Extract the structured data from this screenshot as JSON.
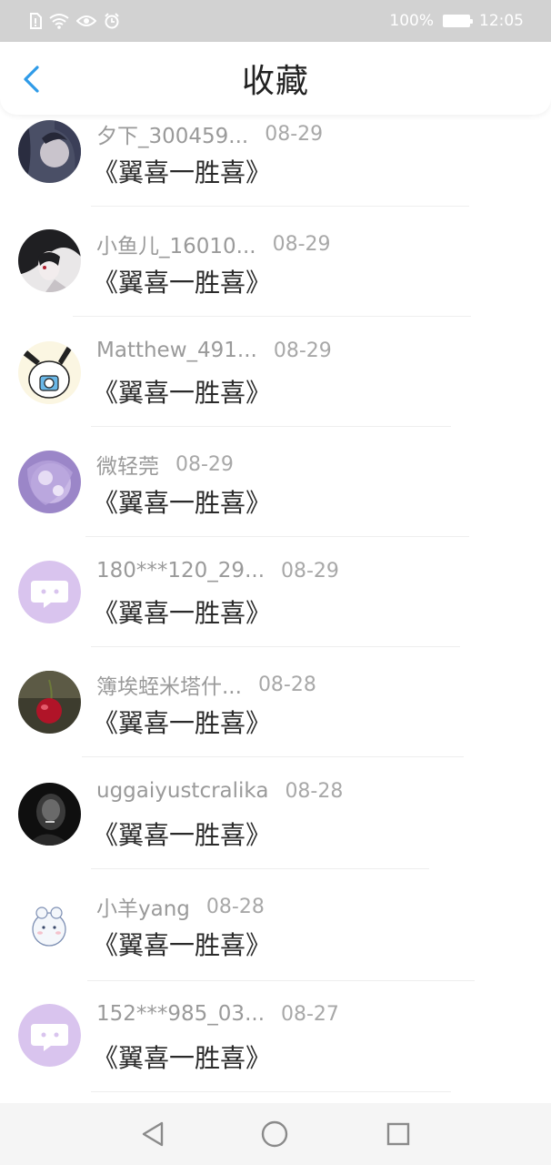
{
  "status_bar": {
    "battery": "100%",
    "time": "12:05"
  },
  "header": {
    "title": "收藏"
  },
  "items": [
    {
      "name": "夕下_300459...",
      "date": "08-29",
      "book": "《翼喜一胜喜》"
    },
    {
      "name": "小鱼儿_16010...",
      "date": "08-29",
      "book": "《翼喜一胜喜》"
    },
    {
      "name": "Matthew_491...",
      "date": "08-29",
      "book": "《翼喜一胜喜》"
    },
    {
      "name": "微轻莞",
      "date": "08-29",
      "book": "《翼喜一胜喜》"
    },
    {
      "name": "180***120_29...",
      "date": "08-29",
      "book": "《翼喜一胜喜》"
    },
    {
      "name": "簿埃蛭米塔什...",
      "date": "08-28",
      "book": "《翼喜一胜喜》"
    },
    {
      "name": "uggaiyustcralika",
      "date": "08-28",
      "book": "《翼喜一胜喜》"
    },
    {
      "name": "小羊yang",
      "date": "08-28",
      "book": "《翼喜一胜喜》"
    },
    {
      "name": "152***985_03...",
      "date": "08-27",
      "book": "《翼喜一胜喜》"
    }
  ],
  "icons": {
    "back": "chevron-left-icon",
    "nav_back": "triangle-back-icon",
    "nav_home": "circle-home-icon",
    "nav_recent": "square-recent-icon"
  },
  "colors": {
    "accent": "#2f9be8",
    "default_avatar": "#d9c4ee"
  }
}
